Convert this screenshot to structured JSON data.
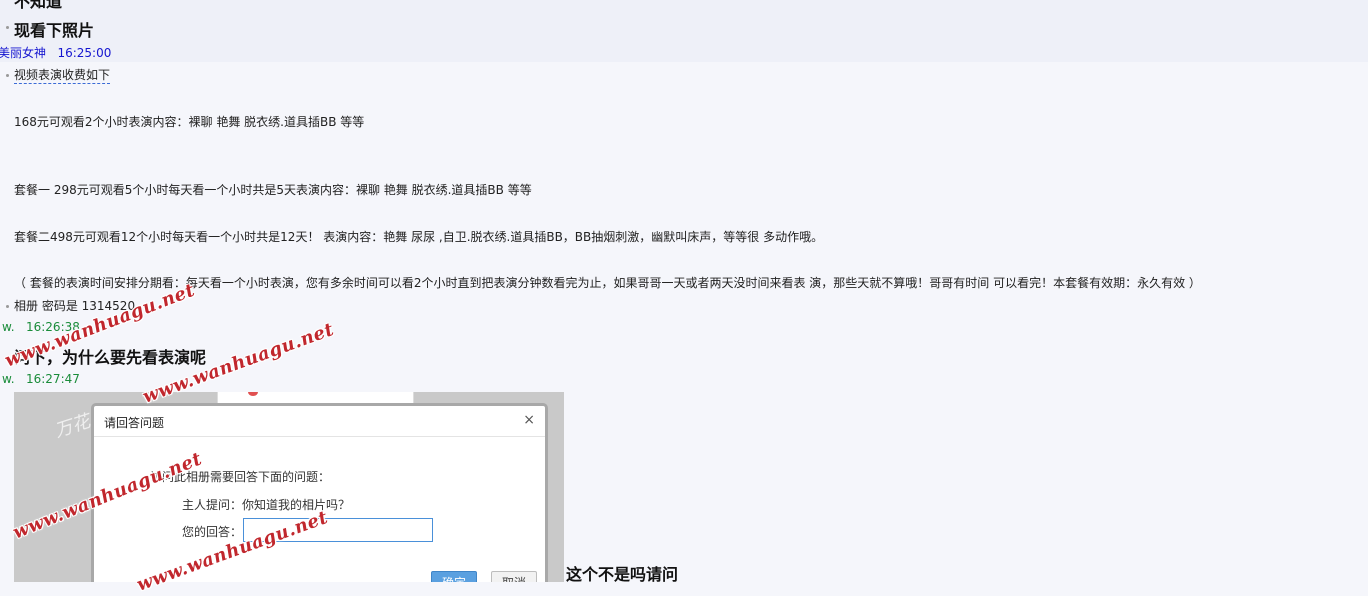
{
  "chat": {
    "top_partial": "不知道",
    "msg_photo": "现看下照片",
    "sender1_name": "美丽女神",
    "sender1_time": "16:25:00",
    "price_heading": "视频表演收费如下",
    "line_168": "168元可观看2个小时表演内容：裸聊 艳舞 脱衣绣.道具插BB 等等",
    "line_pkg1": "套餐一 298元可观看5个小时每天看一个小时共是5天表演内容：裸聊 艳舞 脱衣绣.道具插BB 等等",
    "line_pkg2": "套餐二498元可观看12个小时每天看一个小时共是12天！ 表演内容：艳舞  尿尿 ,自卫.脱衣绣.道具插BB，BB抽烟刺激，幽默叫床声，等等很 多动作哦。",
    "line_note": "（ 套餐的表演时间安排分期看：每天看一个小时表演，您有多余时间可以看2个小时直到把表演分钟数看完为止，如果哥哥一天或者两天没时间来看表 演，那些天就不算哦！哥哥有时间 可以看完！本套餐有效期：永久有效 ）",
    "album_line": "相册 密码是 1314520",
    "sender2_name": "w.",
    "sender2_time1": "16:26:38",
    "question_msg": "问下，为什么要先看表演呢",
    "sender2_time2": "16:27:47",
    "last_msg": "这个不是吗请问"
  },
  "dialog": {
    "title": "请回答问题",
    "close_glyph": "×",
    "intro": "访问此相册需要回答下面的问题：",
    "question": "主人提问：你知道我的相片吗？",
    "answer_label": "您的回答：",
    "answer_value": "",
    "ok_label": "确定",
    "cancel_label": "取消"
  },
  "shot_bg": {
    "wm1": "万花",
    "wm2": "万花"
  },
  "watermark": {
    "text": "www.wanhuagu.net",
    "color": "#c1272d"
  },
  "colors": {
    "sender_blue": "#1515d0",
    "sender_green": "#1a8c3a",
    "dialog_ok": "#5aa0e0"
  }
}
